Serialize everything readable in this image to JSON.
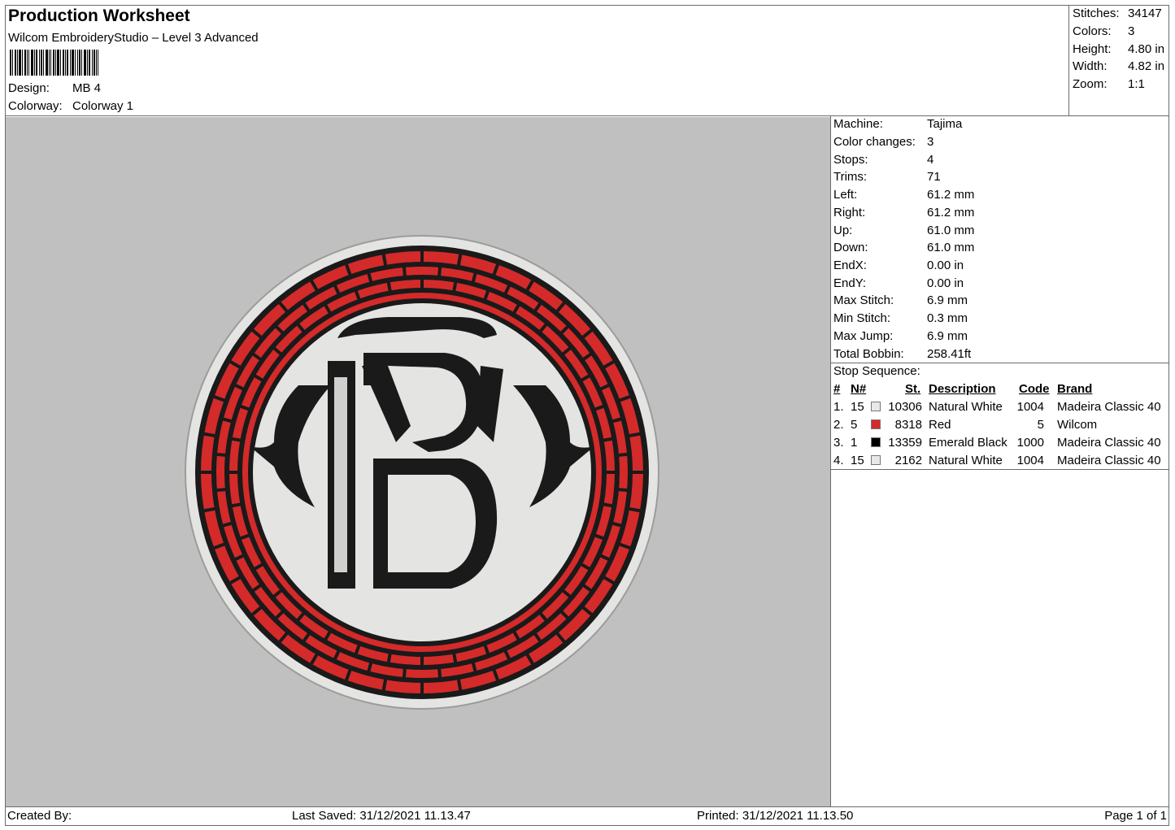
{
  "header": {
    "title": "Production Worksheet",
    "subtitle": "Wilcom EmbroideryStudio – Level 3 Advanced",
    "design_label": "Design:",
    "design_value": "MB 4",
    "colorway_label": "Colorway:",
    "colorway_value": "Colorway 1"
  },
  "summary": {
    "stitches_label": "Stitches:",
    "stitches_value": "34147",
    "colors_label": "Colors:",
    "colors_value": "3",
    "height_label": "Height:",
    "height_value": "4.80 in",
    "width_label": "Width:",
    "width_value": "4.82 in",
    "zoom_label": "Zoom:",
    "zoom_value": "1:1"
  },
  "details": {
    "machine_label": "Machine:",
    "machine_value": "Tajima",
    "color_changes_label": "Color changes:",
    "color_changes_value": "3",
    "stops_label": "Stops:",
    "stops_value": "4",
    "trims_label": "Trims:",
    "trims_value": "71",
    "left_label": "Left:",
    "left_value": "61.2 mm",
    "right_label": "Right:",
    "right_value": "61.2 mm",
    "up_label": "Up:",
    "up_value": "61.0 mm",
    "down_label": "Down:",
    "down_value": "61.0 mm",
    "endx_label": "EndX:",
    "endx_value": "0.00 in",
    "endy_label": "EndY:",
    "endy_value": "0.00 in",
    "max_stitch_label": "Max Stitch:",
    "max_stitch_value": "6.9 mm",
    "min_stitch_label": "Min Stitch:",
    "min_stitch_value": "0.3 mm",
    "max_jump_label": "Max Jump:",
    "max_jump_value": "6.9 mm",
    "total_bobbin_label": "Total Bobbin:",
    "total_bobbin_value": "258.41ft"
  },
  "stop_sequence": {
    "title": "Stop Sequence:",
    "headers": {
      "num": "#",
      "n": "N#",
      "st": "St.",
      "description": "Description",
      "code": "Code",
      "brand": "Brand"
    },
    "rows": [
      {
        "num": "1.",
        "n": "15",
        "st": "10306",
        "description": "Natural White",
        "code": "1004",
        "brand": "Madeira Classic 40",
        "color": "#e8e8ea"
      },
      {
        "num": "2.",
        "n": "5",
        "st": "8318",
        "description": "Red",
        "code": "5",
        "brand": "Wilcom",
        "color": "#d42a2a"
      },
      {
        "num": "3.",
        "n": "1",
        "st": "13359",
        "description": "Emerald Black",
        "code": "1000",
        "brand": "Madeira Classic 40",
        "color": "#000000"
      },
      {
        "num": "4.",
        "n": "15",
        "st": "2162",
        "description": "Natural White",
        "code": "1004",
        "brand": "Madeira Classic 40",
        "color": "#e8e8ea"
      }
    ]
  },
  "footer": {
    "created_by": "Created By:",
    "last_saved": "Last Saved: 31/12/2021 11.13.47",
    "printed": "Printed: 31/12/2021 11.13.50",
    "page": "Page 1 of 1"
  },
  "colors": {
    "canvas": "#c0c0c0",
    "red": "#d42a2a",
    "black": "#1a1a1a",
    "white": "#e4e4e2"
  }
}
